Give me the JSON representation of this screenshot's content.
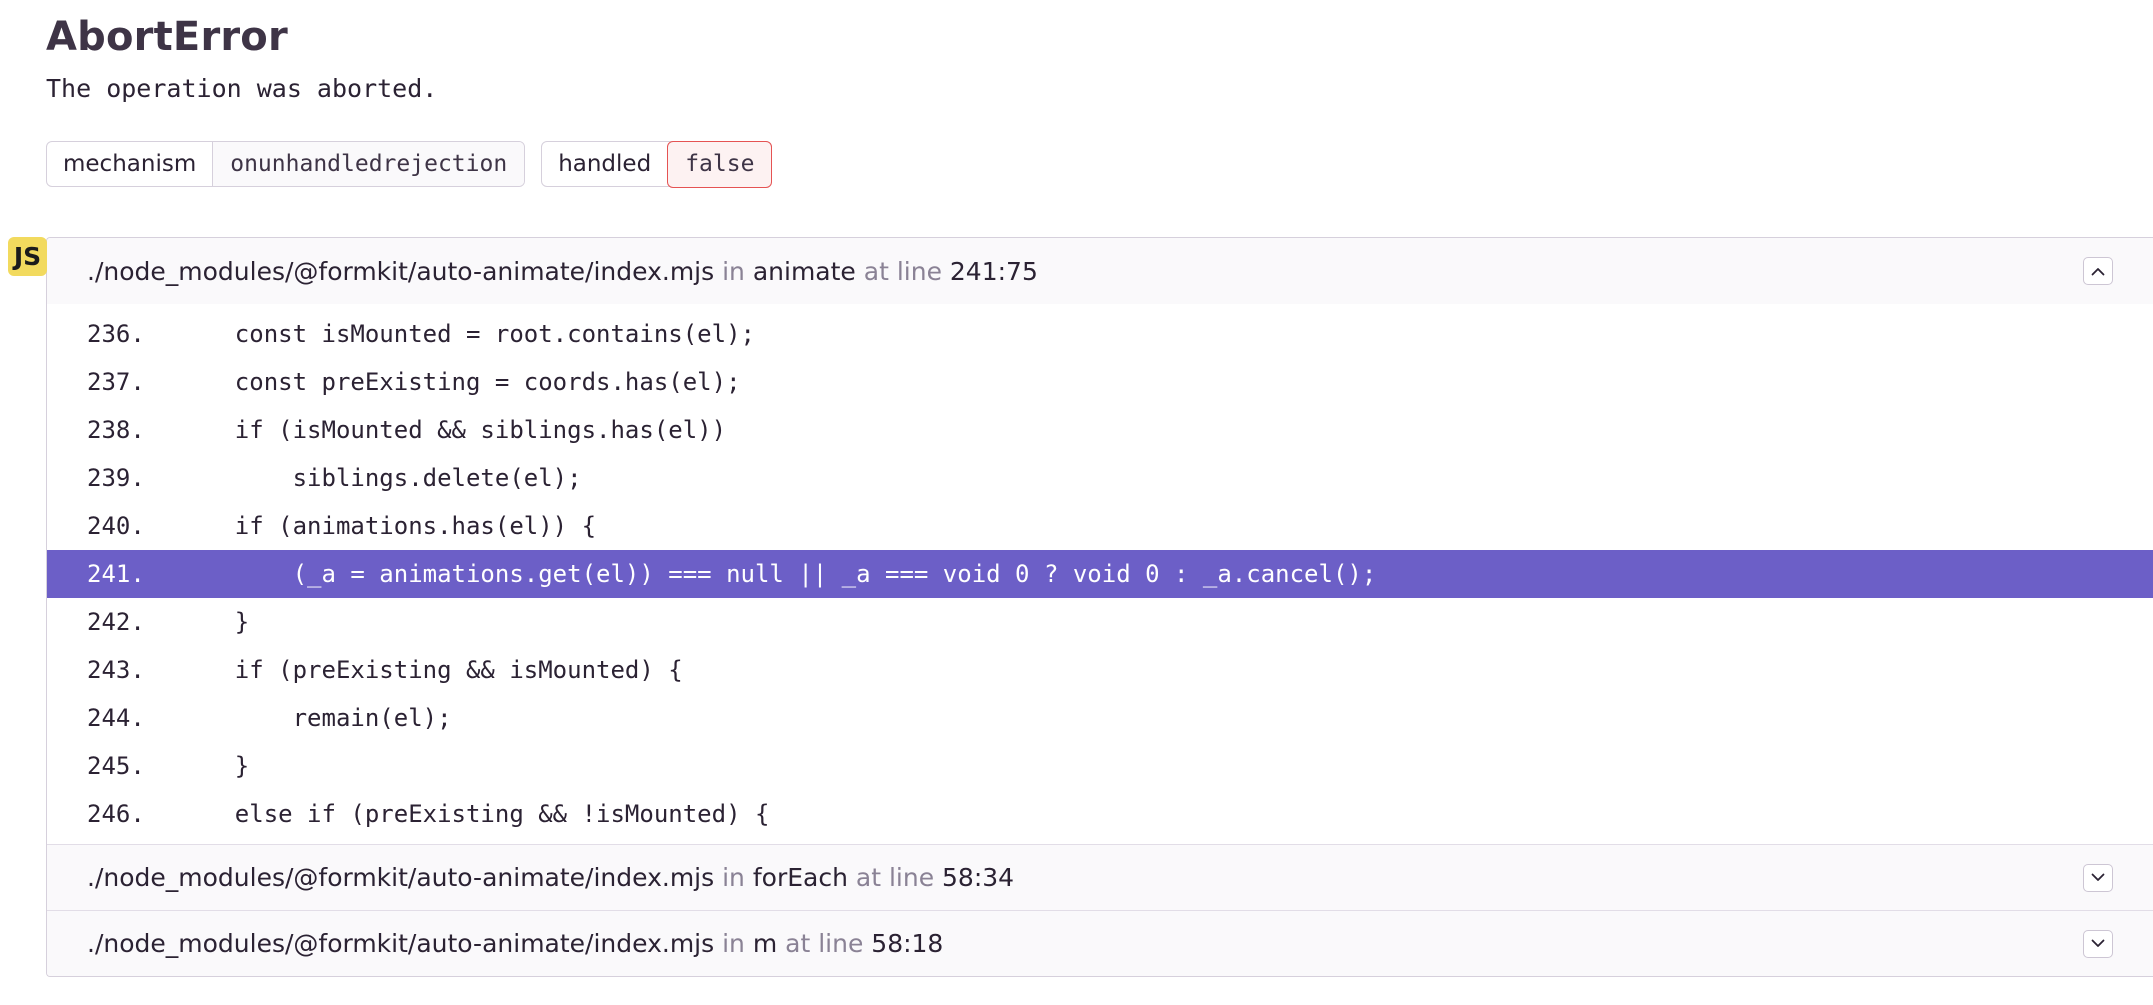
{
  "error": {
    "type": "AbortError",
    "message": "The operation was aborted."
  },
  "tags": [
    {
      "key": "mechanism",
      "value": "onunhandledrejection",
      "status": "normal"
    },
    {
      "key": "handled",
      "value": "false",
      "status": "danger"
    }
  ],
  "platform_badge": "JS",
  "frames": [
    {
      "file": "./node_modules/@formkit/auto-animate/index.mjs",
      "in_label": "in",
      "function": "animate",
      "at_line_label": "at line",
      "location": "241:75",
      "expanded": true,
      "toggle_icon": "chevron-up-icon"
    },
    {
      "file": "./node_modules/@formkit/auto-animate/index.mjs",
      "in_label": "in",
      "function": "forEach",
      "at_line_label": "at line",
      "location": "58:34",
      "expanded": false,
      "toggle_icon": "chevron-down-icon"
    },
    {
      "file": "./node_modules/@formkit/auto-animate/index.mjs",
      "in_label": "in",
      "function": "m",
      "at_line_label": "at line",
      "location": "58:18",
      "expanded": false,
      "toggle_icon": "chevron-down-icon"
    }
  ],
  "code_lines": [
    {
      "number": "236.",
      "code": "    const isMounted = root.contains(el);",
      "active": false
    },
    {
      "number": "237.",
      "code": "    const preExisting = coords.has(el);",
      "active": false
    },
    {
      "number": "238.",
      "code": "    if (isMounted && siblings.has(el))",
      "active": false
    },
    {
      "number": "239.",
      "code": "        siblings.delete(el);",
      "active": false
    },
    {
      "number": "240.",
      "code": "    if (animations.has(el)) {",
      "active": false
    },
    {
      "number": "241.",
      "code": "        (_a = animations.get(el)) === null || _a === void 0 ? void 0 : _a.cancel();",
      "active": true
    },
    {
      "number": "242.",
      "code": "    }",
      "active": false
    },
    {
      "number": "243.",
      "code": "    if (preExisting && isMounted) {",
      "active": false
    },
    {
      "number": "244.",
      "code": "        remain(el);",
      "active": false
    },
    {
      "number": "245.",
      "code": "    }",
      "active": false
    },
    {
      "number": "246.",
      "code": "    else if (preExisting && !isMounted) {",
      "active": false
    }
  ],
  "colors": {
    "highlight": "#6c5fc7",
    "danger_border": "#e55353",
    "badge_yellow": "#f2da5e"
  }
}
